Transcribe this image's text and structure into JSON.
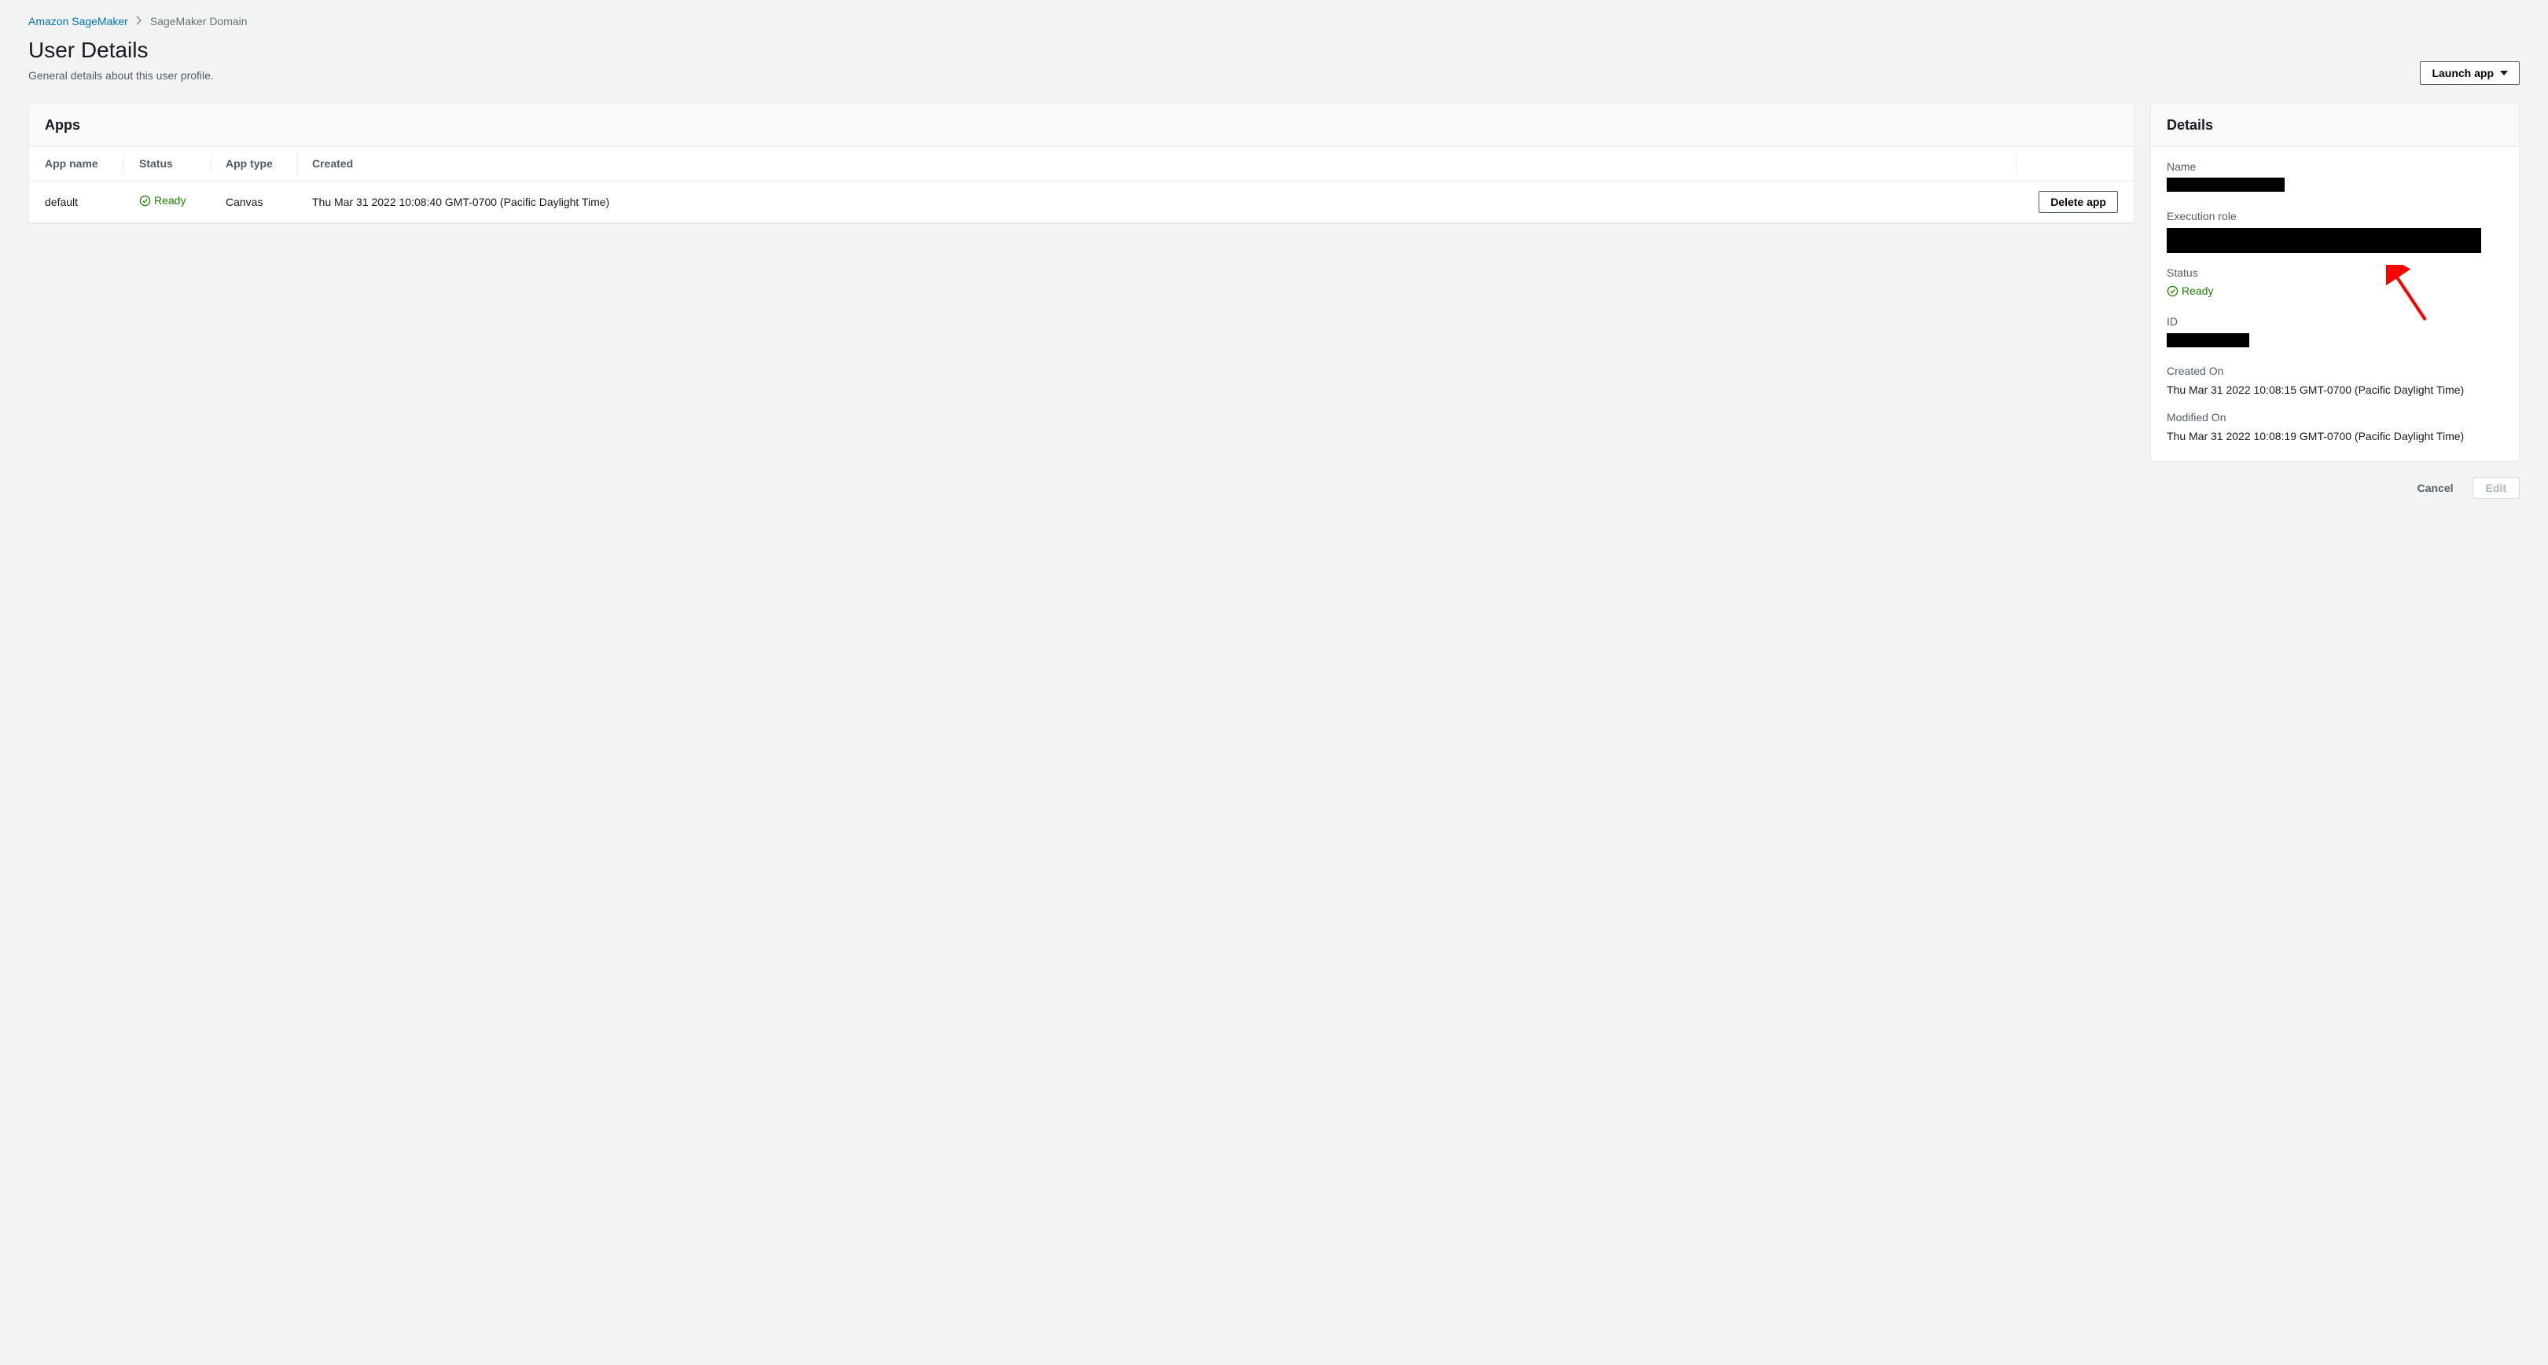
{
  "breadcrumb": {
    "root": "Amazon SageMaker",
    "current": "SageMaker Domain"
  },
  "header": {
    "title": "User Details",
    "subtitle": "General details about this user profile.",
    "launch_label": "Launch app"
  },
  "apps": {
    "panel_title": "Apps",
    "columns": {
      "app_name": "App name",
      "status": "Status",
      "app_type": "App type",
      "created": "Created",
      "action": ""
    },
    "rows": [
      {
        "app_name": "default",
        "status": "Ready",
        "app_type": "Canvas",
        "created": "Thu Mar 31 2022 10:08:40 GMT-0700 (Pacific Daylight Time)",
        "delete_label": "Delete app"
      }
    ]
  },
  "details": {
    "panel_title": "Details",
    "name_label": "Name",
    "execution_role_label": "Execution role",
    "status_label": "Status",
    "status_value": "Ready",
    "id_label": "ID",
    "created_label": "Created On",
    "created_value": "Thu Mar 31 2022 10:08:15 GMT-0700 (Pacific Daylight Time)",
    "modified_label": "Modified On",
    "modified_value": "Thu Mar 31 2022 10:08:19 GMT-0700 (Pacific Daylight Time)"
  },
  "footer": {
    "cancel": "Cancel",
    "edit": "Edit"
  }
}
